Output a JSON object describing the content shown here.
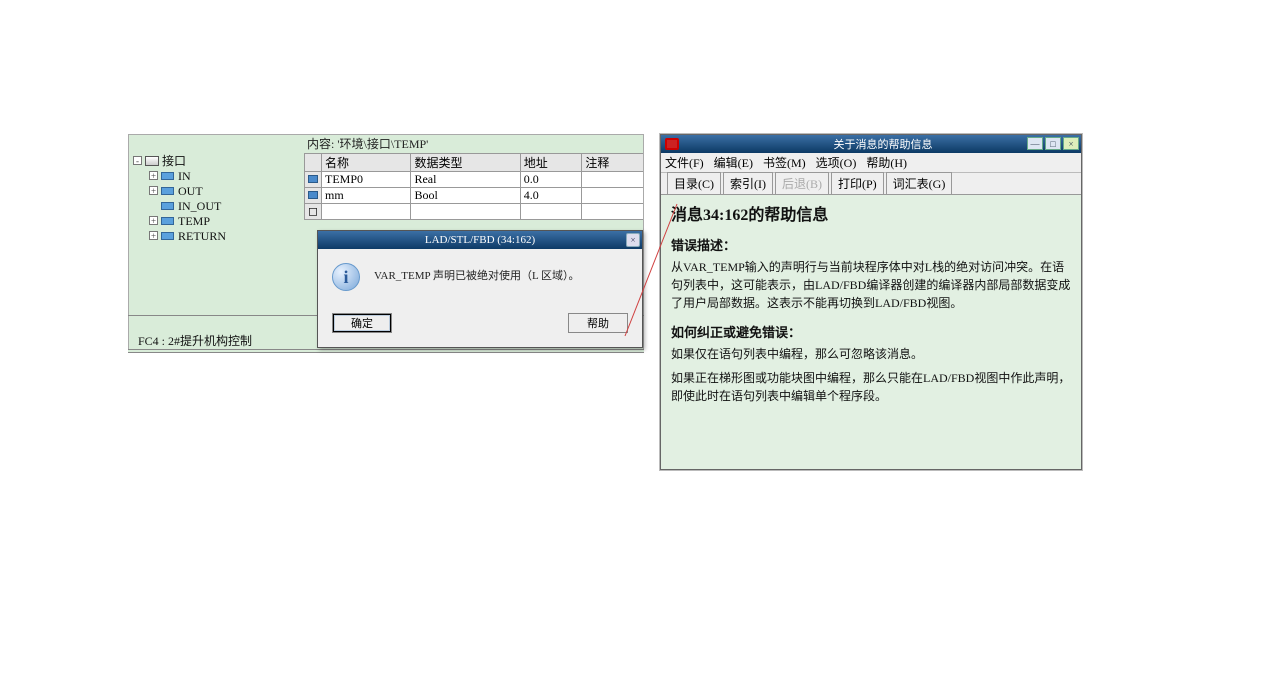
{
  "editor": {
    "content_label": "内容: '环境\\接口\\TEMP'",
    "tree": {
      "root": "接口",
      "items": [
        "IN",
        "OUT",
        "IN_OUT",
        "TEMP",
        "RETURN"
      ]
    },
    "table": {
      "headers": {
        "name": "名称",
        "dtype": "数据类型",
        "addr": "地址",
        "comment": "注释"
      },
      "rows": [
        {
          "name": "TEMP0",
          "dtype": "Real",
          "addr": "0.0",
          "comment": ""
        },
        {
          "name": "mm",
          "dtype": "Bool",
          "addr": "4.0",
          "comment": ""
        }
      ]
    },
    "fc_label": "FC4 : 2#提升机构控制"
  },
  "dialog": {
    "title": "LAD/STL/FBD  (34:162)",
    "message": "VAR_TEMP 声明已被绝对使用（L 区域）。",
    "ok": "确定",
    "help": "帮助",
    "close_glyph": "×"
  },
  "help": {
    "window_title": "关于消息的帮助信息",
    "menus": {
      "file": "文件(F)",
      "edit": "编辑(E)",
      "bookmark": "书签(M)",
      "options": "选项(O)",
      "help": "帮助(H)"
    },
    "tabs": {
      "contents": "目录(C)",
      "index": "索引(I)",
      "back": "后退(B)",
      "print": "打印(P)",
      "glossary": "词汇表(G)"
    },
    "heading": "消息34:162的帮助信息",
    "sec1_title": "错误描述：",
    "sec1_body": "从VAR_TEMP输入的声明行与当前块程序体中对L栈的绝对访问冲突。在语句列表中，这可能表示，由LAD/FBD编译器创建的编译器内部局部数据变成了用户局部数据。这表示不能再切换到LAD/FBD视图。",
    "sec2_title": "如何纠正或避免错误：",
    "sec2_body_a": "如果仅在语句列表中编程，那么可忽略该消息。",
    "sec2_body_b": "如果正在梯形图或功能块图中编程，那么只能在LAD/FBD视图中作此声明，即使此时在语句列表中编辑单个程序段。",
    "win_btns": {
      "min": "—",
      "max": "□",
      "close": "×"
    }
  }
}
